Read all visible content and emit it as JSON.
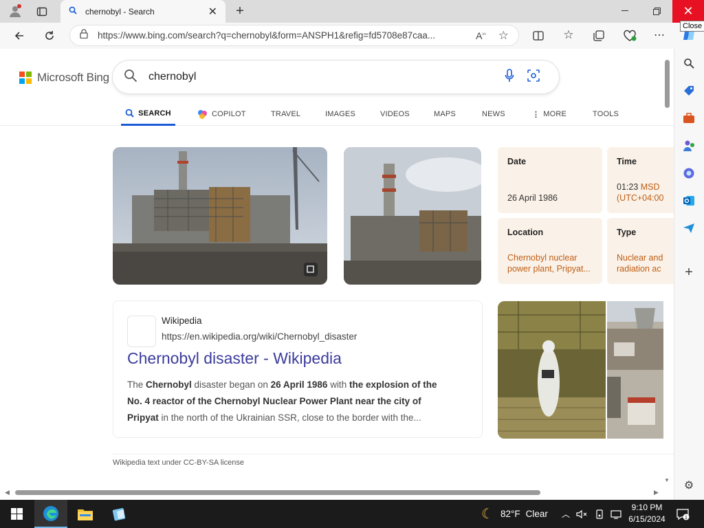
{
  "browser": {
    "tab_title": "chernobyl - Search",
    "url": "https://www.bing.com/search?q=chernobyl&form=ANSPH1&refig=fd5708e87caa...",
    "close_tooltip": "Close"
  },
  "bing": {
    "logo_text": "Microsoft Bing",
    "logo_colors": [
      "#f25022",
      "#7fba00",
      "#00a4ef",
      "#ffb900"
    ],
    "search_query": "chernobyl",
    "scopes": [
      "SEARCH",
      "COPILOT",
      "TRAVEL",
      "IMAGES",
      "VIDEOS",
      "MAPS",
      "NEWS",
      "MORE",
      "TOOLS"
    ],
    "accent_color": "#1a5bd6"
  },
  "facts": {
    "date_label": "Date",
    "date_value": "26 April 1986",
    "time_label": "Time",
    "time_value": "01:23",
    "time_zone": "MSD",
    "time_offset": "(UTC+04:00",
    "location_label": "Location",
    "location_line1": "Chernobyl nuclear",
    "location_line2": "power plant, Pripyat...",
    "type_label": "Type",
    "type_line1": "Nuclear and",
    "type_line2": "radiation ac"
  },
  "result": {
    "site_name": "Wikipedia",
    "site_url": "https://en.wikipedia.org/wiki/Chernobyl_disaster",
    "title": "Chernobyl disaster - Wikipedia",
    "snippet": {
      "s1": "The ",
      "b1": "Chernobyl",
      "s2": " disaster began on ",
      "b2": "26 April 1986",
      "s3": " with ",
      "b3": "the explosion of the No. 4 reactor of the Chernobyl Nuclear Power Plant near the city of Pripyat",
      "s4": " in the north of the Ukrainian SSR, close to the border with the..."
    },
    "license": "Wikipedia text under CC-BY-SA license"
  },
  "taskbar": {
    "temperature": "82°F",
    "weather": "Clear",
    "time": "9:10 PM",
    "date": "6/15/2024",
    "notification_count": "1"
  }
}
